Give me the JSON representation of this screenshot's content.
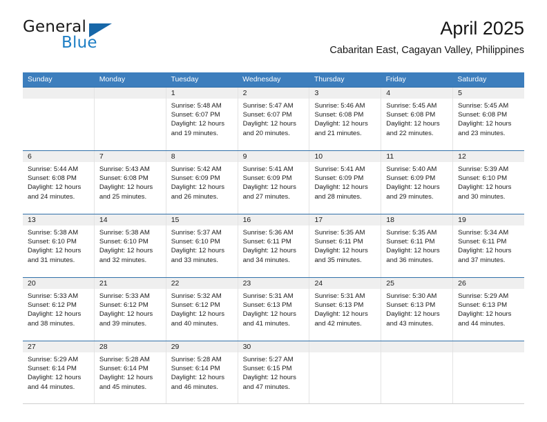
{
  "brand": {
    "word1": "General",
    "word2": "Blue",
    "logo_icon": "blue-triangle-icon",
    "accent_color": "#1d7ec4"
  },
  "header": {
    "title": "April 2025",
    "subtitle": "Cabaritan East, Cagayan Valley, Philippines"
  },
  "theme": {
    "header_blue": "#3d7ebd",
    "rule_blue": "#2f6fa8",
    "day_band_gray": "#efefef"
  },
  "calendar": {
    "weekday_headers": [
      "Sunday",
      "Monday",
      "Tuesday",
      "Wednesday",
      "Thursday",
      "Friday",
      "Saturday"
    ],
    "weeks": [
      [
        {
          "day": "",
          "sunrise": "",
          "sunset": "",
          "daylight_1": "",
          "daylight_2": ""
        },
        {
          "day": "",
          "sunrise": "",
          "sunset": "",
          "daylight_1": "",
          "daylight_2": ""
        },
        {
          "day": "1",
          "sunrise": "Sunrise: 5:48 AM",
          "sunset": "Sunset: 6:07 PM",
          "daylight_1": "Daylight: 12 hours",
          "daylight_2": "and 19 minutes."
        },
        {
          "day": "2",
          "sunrise": "Sunrise: 5:47 AM",
          "sunset": "Sunset: 6:07 PM",
          "daylight_1": "Daylight: 12 hours",
          "daylight_2": "and 20 minutes."
        },
        {
          "day": "3",
          "sunrise": "Sunrise: 5:46 AM",
          "sunset": "Sunset: 6:08 PM",
          "daylight_1": "Daylight: 12 hours",
          "daylight_2": "and 21 minutes."
        },
        {
          "day": "4",
          "sunrise": "Sunrise: 5:45 AM",
          "sunset": "Sunset: 6:08 PM",
          "daylight_1": "Daylight: 12 hours",
          "daylight_2": "and 22 minutes."
        },
        {
          "day": "5",
          "sunrise": "Sunrise: 5:45 AM",
          "sunset": "Sunset: 6:08 PM",
          "daylight_1": "Daylight: 12 hours",
          "daylight_2": "and 23 minutes."
        }
      ],
      [
        {
          "day": "6",
          "sunrise": "Sunrise: 5:44 AM",
          "sunset": "Sunset: 6:08 PM",
          "daylight_1": "Daylight: 12 hours",
          "daylight_2": "and 24 minutes."
        },
        {
          "day": "7",
          "sunrise": "Sunrise: 5:43 AM",
          "sunset": "Sunset: 6:08 PM",
          "daylight_1": "Daylight: 12 hours",
          "daylight_2": "and 25 minutes."
        },
        {
          "day": "8",
          "sunrise": "Sunrise: 5:42 AM",
          "sunset": "Sunset: 6:09 PM",
          "daylight_1": "Daylight: 12 hours",
          "daylight_2": "and 26 minutes."
        },
        {
          "day": "9",
          "sunrise": "Sunrise: 5:41 AM",
          "sunset": "Sunset: 6:09 PM",
          "daylight_1": "Daylight: 12 hours",
          "daylight_2": "and 27 minutes."
        },
        {
          "day": "10",
          "sunrise": "Sunrise: 5:41 AM",
          "sunset": "Sunset: 6:09 PM",
          "daylight_1": "Daylight: 12 hours",
          "daylight_2": "and 28 minutes."
        },
        {
          "day": "11",
          "sunrise": "Sunrise: 5:40 AM",
          "sunset": "Sunset: 6:09 PM",
          "daylight_1": "Daylight: 12 hours",
          "daylight_2": "and 29 minutes."
        },
        {
          "day": "12",
          "sunrise": "Sunrise: 5:39 AM",
          "sunset": "Sunset: 6:10 PM",
          "daylight_1": "Daylight: 12 hours",
          "daylight_2": "and 30 minutes."
        }
      ],
      [
        {
          "day": "13",
          "sunrise": "Sunrise: 5:38 AM",
          "sunset": "Sunset: 6:10 PM",
          "daylight_1": "Daylight: 12 hours",
          "daylight_2": "and 31 minutes."
        },
        {
          "day": "14",
          "sunrise": "Sunrise: 5:38 AM",
          "sunset": "Sunset: 6:10 PM",
          "daylight_1": "Daylight: 12 hours",
          "daylight_2": "and 32 minutes."
        },
        {
          "day": "15",
          "sunrise": "Sunrise: 5:37 AM",
          "sunset": "Sunset: 6:10 PM",
          "daylight_1": "Daylight: 12 hours",
          "daylight_2": "and 33 minutes."
        },
        {
          "day": "16",
          "sunrise": "Sunrise: 5:36 AM",
          "sunset": "Sunset: 6:11 PM",
          "daylight_1": "Daylight: 12 hours",
          "daylight_2": "and 34 minutes."
        },
        {
          "day": "17",
          "sunrise": "Sunrise: 5:35 AM",
          "sunset": "Sunset: 6:11 PM",
          "daylight_1": "Daylight: 12 hours",
          "daylight_2": "and 35 minutes."
        },
        {
          "day": "18",
          "sunrise": "Sunrise: 5:35 AM",
          "sunset": "Sunset: 6:11 PM",
          "daylight_1": "Daylight: 12 hours",
          "daylight_2": "and 36 minutes."
        },
        {
          "day": "19",
          "sunrise": "Sunrise: 5:34 AM",
          "sunset": "Sunset: 6:11 PM",
          "daylight_1": "Daylight: 12 hours",
          "daylight_2": "and 37 minutes."
        }
      ],
      [
        {
          "day": "20",
          "sunrise": "Sunrise: 5:33 AM",
          "sunset": "Sunset: 6:12 PM",
          "daylight_1": "Daylight: 12 hours",
          "daylight_2": "and 38 minutes."
        },
        {
          "day": "21",
          "sunrise": "Sunrise: 5:33 AM",
          "sunset": "Sunset: 6:12 PM",
          "daylight_1": "Daylight: 12 hours",
          "daylight_2": "and 39 minutes."
        },
        {
          "day": "22",
          "sunrise": "Sunrise: 5:32 AM",
          "sunset": "Sunset: 6:12 PM",
          "daylight_1": "Daylight: 12 hours",
          "daylight_2": "and 40 minutes."
        },
        {
          "day": "23",
          "sunrise": "Sunrise: 5:31 AM",
          "sunset": "Sunset: 6:13 PM",
          "daylight_1": "Daylight: 12 hours",
          "daylight_2": "and 41 minutes."
        },
        {
          "day": "24",
          "sunrise": "Sunrise: 5:31 AM",
          "sunset": "Sunset: 6:13 PM",
          "daylight_1": "Daylight: 12 hours",
          "daylight_2": "and 42 minutes."
        },
        {
          "day": "25",
          "sunrise": "Sunrise: 5:30 AM",
          "sunset": "Sunset: 6:13 PM",
          "daylight_1": "Daylight: 12 hours",
          "daylight_2": "and 43 minutes."
        },
        {
          "day": "26",
          "sunrise": "Sunrise: 5:29 AM",
          "sunset": "Sunset: 6:13 PM",
          "daylight_1": "Daylight: 12 hours",
          "daylight_2": "and 44 minutes."
        }
      ],
      [
        {
          "day": "27",
          "sunrise": "Sunrise: 5:29 AM",
          "sunset": "Sunset: 6:14 PM",
          "daylight_1": "Daylight: 12 hours",
          "daylight_2": "and 44 minutes."
        },
        {
          "day": "28",
          "sunrise": "Sunrise: 5:28 AM",
          "sunset": "Sunset: 6:14 PM",
          "daylight_1": "Daylight: 12 hours",
          "daylight_2": "and 45 minutes."
        },
        {
          "day": "29",
          "sunrise": "Sunrise: 5:28 AM",
          "sunset": "Sunset: 6:14 PM",
          "daylight_1": "Daylight: 12 hours",
          "daylight_2": "and 46 minutes."
        },
        {
          "day": "30",
          "sunrise": "Sunrise: 5:27 AM",
          "sunset": "Sunset: 6:15 PM",
          "daylight_1": "Daylight: 12 hours",
          "daylight_2": "and 47 minutes."
        },
        {
          "day": "",
          "sunrise": "",
          "sunset": "",
          "daylight_1": "",
          "daylight_2": ""
        },
        {
          "day": "",
          "sunrise": "",
          "sunset": "",
          "daylight_1": "",
          "daylight_2": ""
        },
        {
          "day": "",
          "sunrise": "",
          "sunset": "",
          "daylight_1": "",
          "daylight_2": ""
        }
      ]
    ]
  }
}
